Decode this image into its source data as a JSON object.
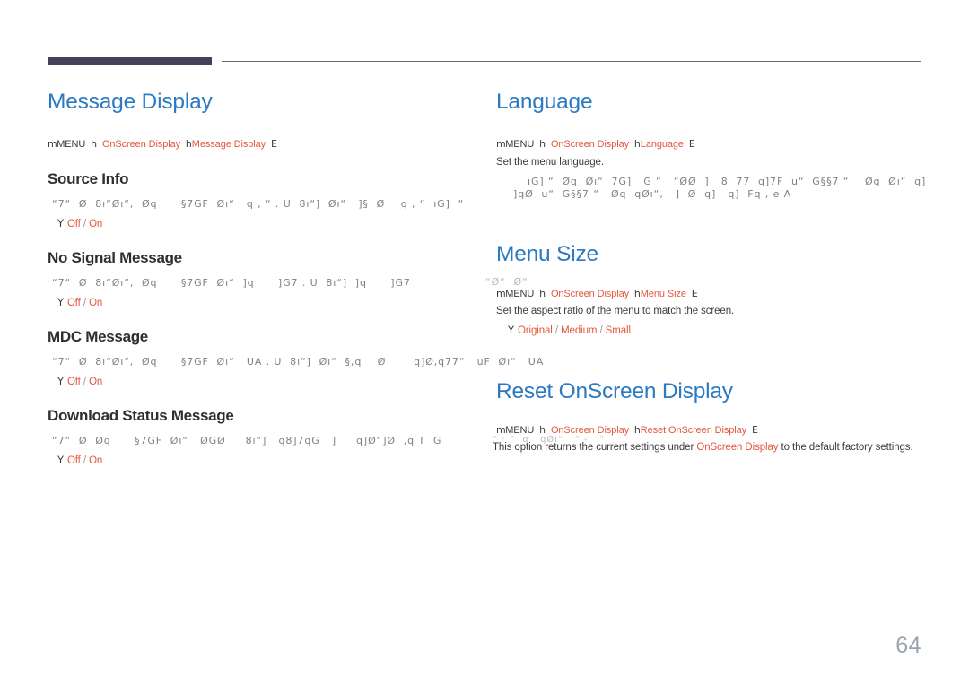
{
  "page": {
    "number": "64",
    "accent_color": "#e4573d",
    "heading_color": "#2b7ac2",
    "header_tab_color": "#47405a",
    "page_number_color": "#9aa4ae"
  },
  "left_column": {
    "section_title": "Message Display",
    "breadcrumb": {
      "prefix_icon": "m",
      "root": "MENU",
      "arrow1": "h",
      "level1": "OnScreen Display",
      "arrow2": "h",
      "level2": "Message Display",
      "enter_icon": "E"
    },
    "items": [
      {
        "title": "Source Info",
        "garbled_line": "“7“  Ø  8ı“Øı“,  Øq      §7GF  Øı“   q , “ . U  8ı“]  Øı“   ]§  Ø    q , “  ıG]  “",
        "option_bullet": "Y",
        "options": [
          "Off",
          "On"
        ]
      },
      {
        "title": "No Signal Message",
        "garbled_line": "“7“  Ø  8ı“Øı“,  Øq      §7GF  Øı“  ]q      ]G7 . U  8ı“]  ]q      ]G7",
        "option_bullet": "Y",
        "options": [
          "Off",
          "On"
        ]
      },
      {
        "title": "MDC Message",
        "garbled_line": "“7“  Ø  8ı“Øı“,  Øq      §7GF  Øı“   UA . U  8ı“]  Øı“  §,q    Ø       q]Ø,q77“   uF  Øı“   UA",
        "option_bullet": "Y",
        "options": [
          "Off",
          "On"
        ]
      },
      {
        "title": "Download Status Message",
        "garbled_line": "“7“  Ø  Øq      §7GF  Øı“   ØGØ     8ı“]   q8]7qG   ]     q]Ø“]Ø  ,q T  G",
        "option_bullet": "Y",
        "options": [
          "Off",
          "On"
        ]
      }
    ]
  },
  "right_column": {
    "language": {
      "section_title": "Language",
      "breadcrumb": {
        "prefix_icon": "m",
        "root": "MENU",
        "arrow1": "h",
        "level1": "OnScreen Display",
        "arrow2": "h",
        "level2": "Language",
        "enter_icon": "E"
      },
      "description": "Set the menu language.",
      "garbled_line_1": "ıG] “  Øq  Øı“  7G]   G “   “ØØ  ]   8  77  q]7F  u“  G§§7 “    Øq  Øı“  q]",
      "garbled_line_2": "]qØ  u“  G§§7 “   Øq  qØı“,   ]  Ø  q]   q]  Fq , e A"
    },
    "menu_size": {
      "section_title": "Menu Size",
      "garbled_overlap": "“Ø“  Ø“",
      "breadcrumb": {
        "prefix_icon": "m",
        "root": "MENU",
        "arrow1": "h",
        "level1": "OnScreen Display",
        "arrow2": "h",
        "level2": "Menu Size",
        "enter_icon": "E"
      },
      "description": "Set the aspect ratio of the menu to match the screen.",
      "option_bullet": "Y",
      "options": [
        "Original",
        "Medium",
        "Small"
      ]
    },
    "reset_osd": {
      "section_title": "Reset OnScreen Display",
      "breadcrumb": {
        "prefix_icon": "m",
        "root": "MENU",
        "arrow1": "h",
        "level1": "OnScreen Display",
        "arrow2": "h",
        "level2": "Reset OnScreen Display",
        "enter_icon": "E"
      },
      "garbled_overlap": "“ · “  q   qØı“   “ -   “",
      "description_before": "This option returns the current settings under ",
      "description_link": "OnScreen Display",
      "description_after": " to the default factory settings."
    }
  }
}
